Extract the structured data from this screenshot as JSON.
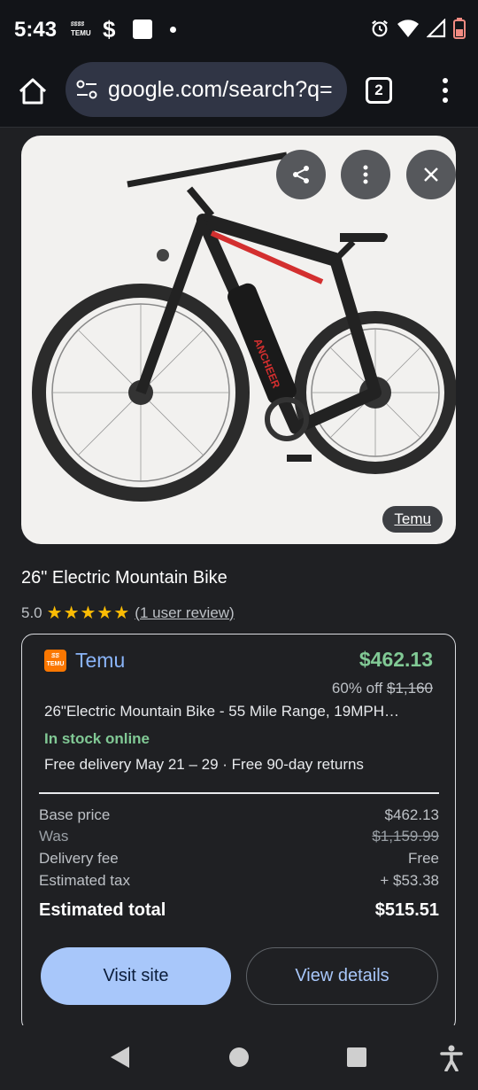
{
  "status_bar": {
    "time": "5:43",
    "temu_line1": "ꕷꕷꕷꕷ",
    "temu_line2": "TEMU",
    "dollar": "$"
  },
  "browser": {
    "url": "google.com/search?q=",
    "tab_count": "2"
  },
  "image": {
    "source_label": "Temu",
    "bike_frame_text": "ANCHEER"
  },
  "product": {
    "title": "26\" Electric Mountain Bike",
    "rating_value": "5.0",
    "stars": "★★★★★",
    "review_text": "(1 user review)"
  },
  "offer": {
    "merchant": "Temu",
    "price": "$462.13",
    "discount_text": "60% off ",
    "original_price": "$1,160",
    "description": "26\"Electric Mountain Bike - 55 Mile Range, 19MPH…",
    "stock": "In stock online",
    "delivery": "Free delivery May 21 – 29 · Free 90-day returns",
    "breakdown": [
      {
        "label": "Base price",
        "value": "$462.13"
      },
      {
        "label": "Was",
        "value": "$1,159.99"
      },
      {
        "label": "Delivery fee",
        "value": "Free"
      },
      {
        "label": "Estimated tax",
        "value": "+ $53.38"
      }
    ],
    "total_label": "Estimated total",
    "total_value": "$515.51",
    "visit_label": "Visit site",
    "details_label": "View details"
  },
  "colors": {
    "price_green": "#81c995",
    "link_blue": "#8ab4f8",
    "button_blue": "#a8c7fa",
    "temu_orange": "#fb7701",
    "star_yellow": "#fbbc04"
  },
  "icons": [
    "home-icon",
    "tune-icon",
    "more-vert-icon",
    "share-icon",
    "close-icon",
    "back-icon",
    "home-circle-icon",
    "recents-icon",
    "accessibility-icon",
    "alarm-icon",
    "wifi-icon",
    "signal-icon",
    "battery-icon"
  ]
}
